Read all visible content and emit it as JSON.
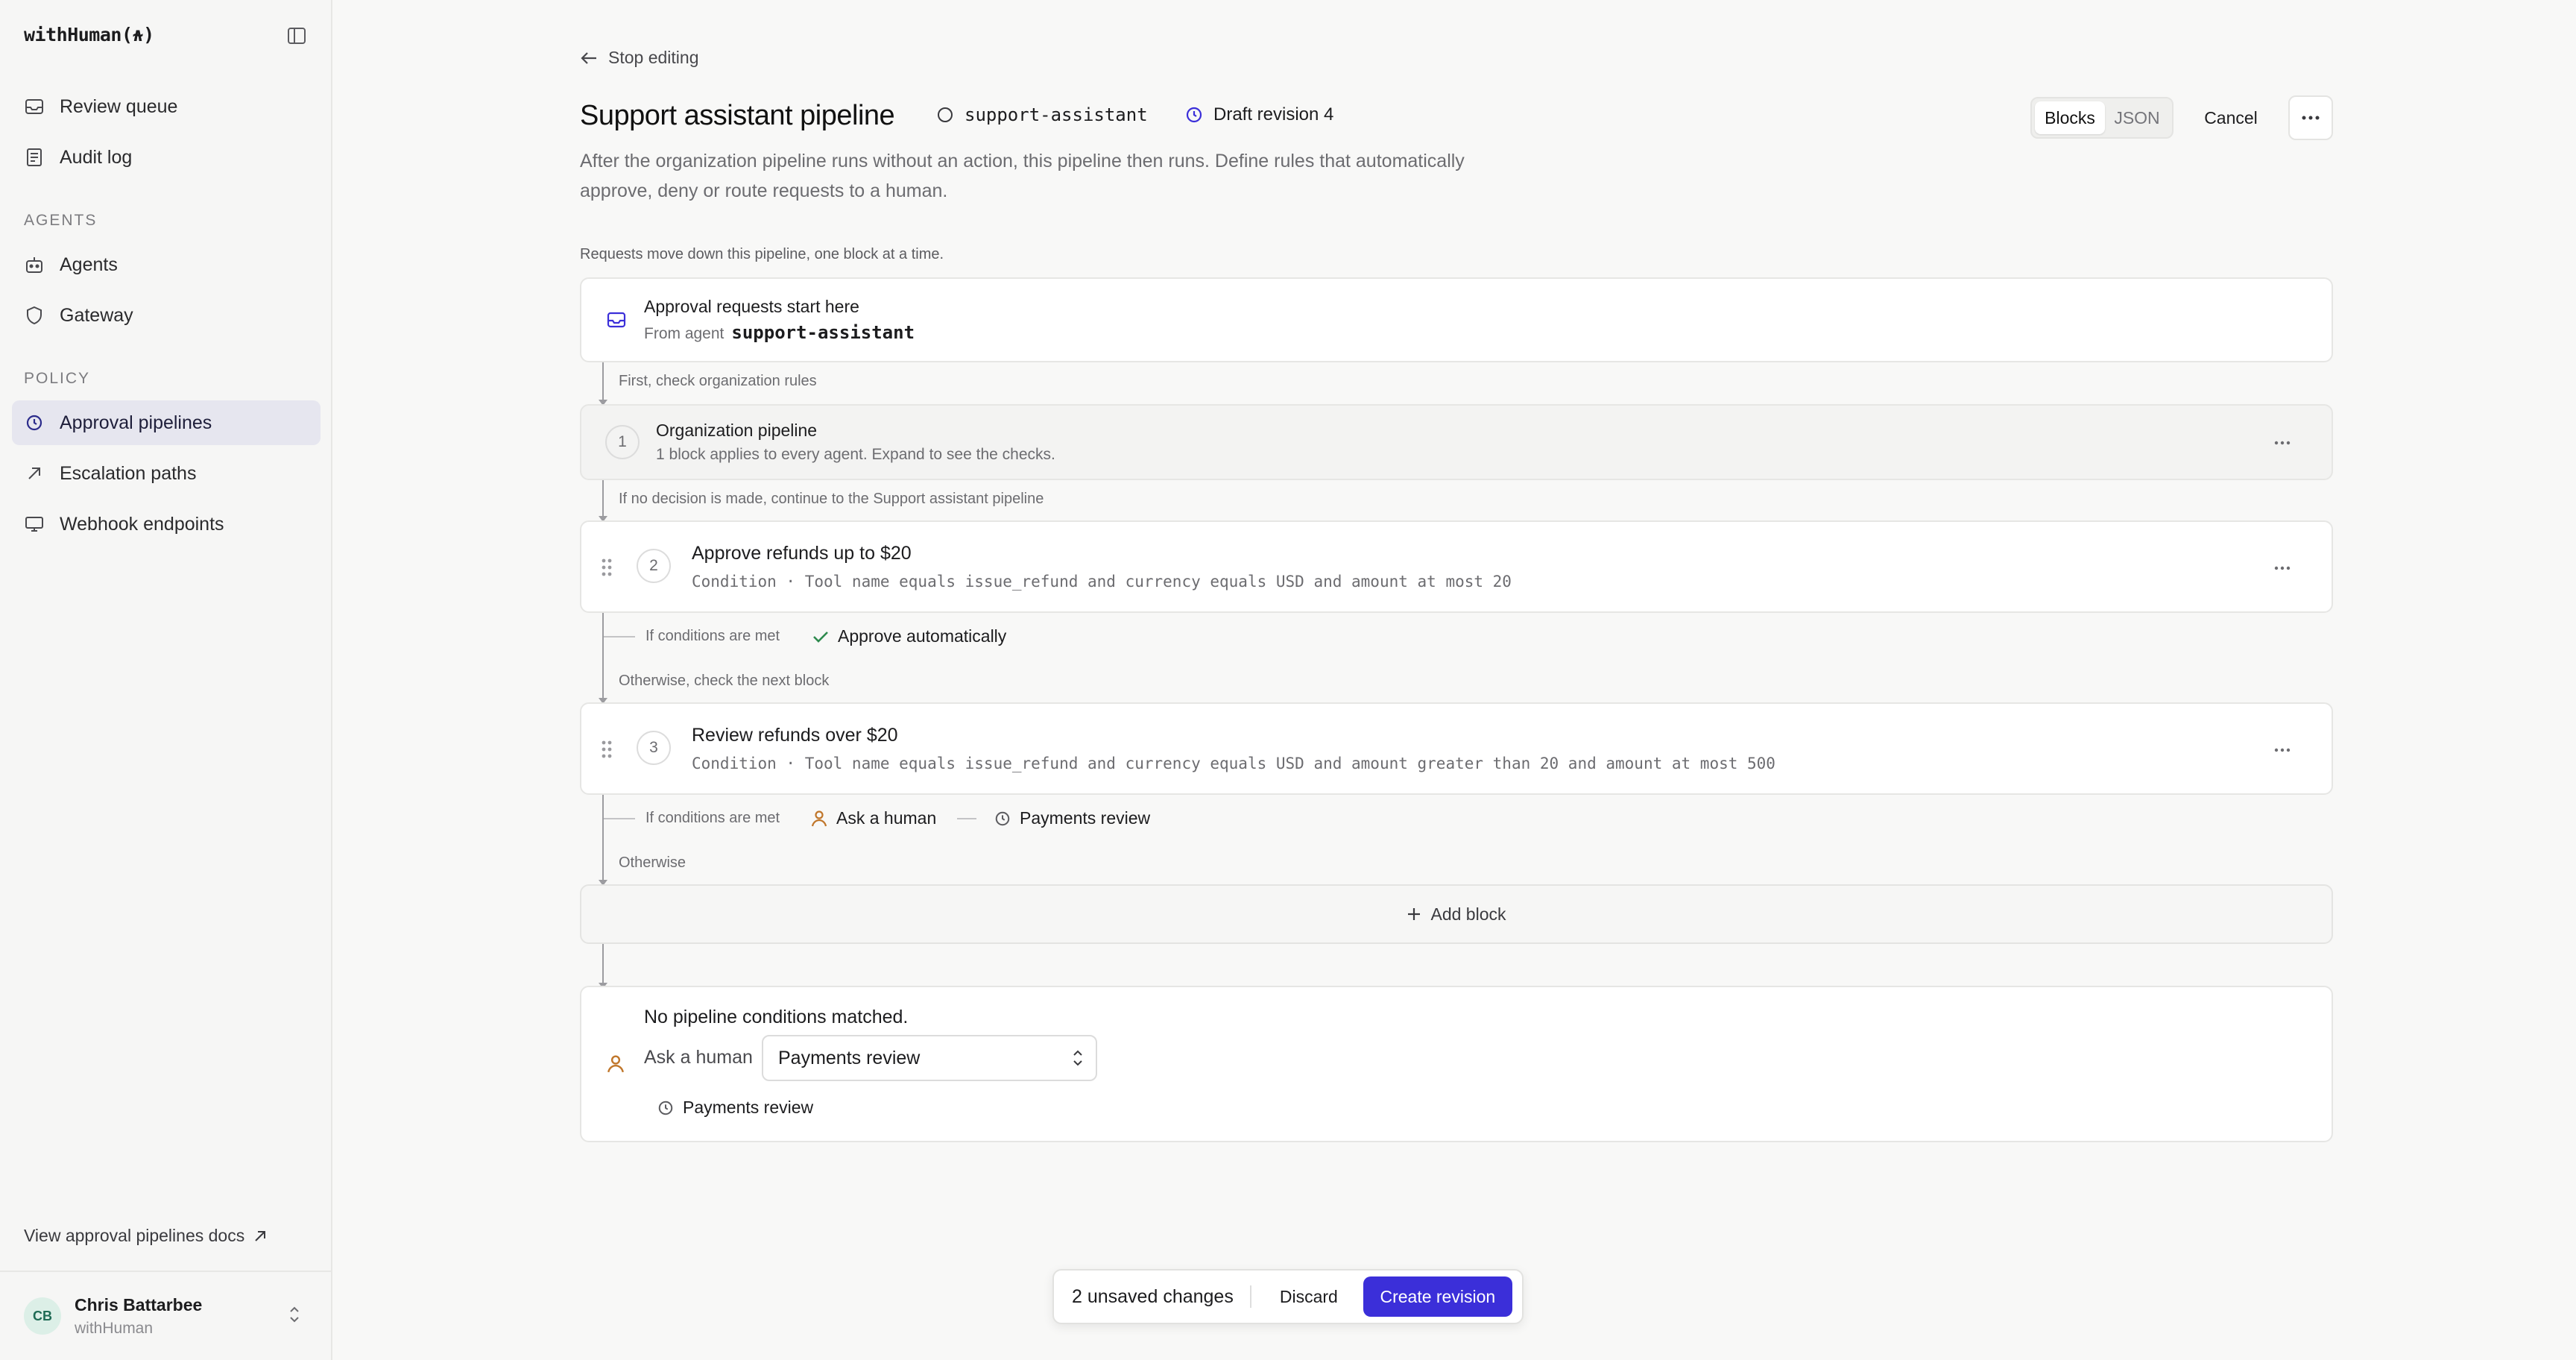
{
  "app": {
    "logo": "withHuman(⍲)"
  },
  "sidebar": {
    "items": [
      {
        "label": "Review queue",
        "icon": "inbox-icon"
      },
      {
        "label": "Audit log",
        "icon": "document-icon"
      },
      {
        "label": "Agents",
        "icon": "robot-icon"
      },
      {
        "label": "Gateway",
        "icon": "shield-icon"
      },
      {
        "label": "Approval pipelines",
        "icon": "pipeline-icon",
        "active": true
      },
      {
        "label": "Escalation paths",
        "icon": "arrow-up-right-icon"
      },
      {
        "label": "Webhook endpoints",
        "icon": "monitor-icon"
      }
    ],
    "sections": {
      "agents": "AGENTS",
      "policy": "POLICY"
    },
    "docs_link": "View approval pipelines docs",
    "user": {
      "initials": "CB",
      "name": "Chris Battarbee",
      "org": "withHuman"
    }
  },
  "header": {
    "back_label": "Stop editing",
    "title": "Support assistant pipeline",
    "agent": "support-assistant",
    "revision": "Draft revision 4",
    "view_tabs": [
      "Blocks",
      "JSON"
    ],
    "active_tab": "Blocks",
    "cancel_label": "Cancel",
    "description": "After the organization pipeline runs without an action, this pipeline then runs. Define rules that automatically approve, deny or route requests to a human."
  },
  "pipeline": {
    "hint": "Requests move down this pipeline, one block at a time.",
    "start": {
      "title": "Approval requests start here",
      "from_label": "From agent",
      "agent": "support-assistant"
    },
    "step1_label": "First, check organization rules",
    "org_block": {
      "number": "1",
      "title": "Organization pipeline",
      "subtitle": "1 block applies to every agent. Expand to see the checks."
    },
    "step2_label": "If no decision is made, continue to the Support assistant pipeline",
    "blocks": [
      {
        "number": "2",
        "title": "Approve refunds up to $20",
        "condition": "Condition · Tool name equals issue_refund and currency equals USD and amount at most 20",
        "if_label": "If conditions are met",
        "outcome": "Approve automatically",
        "next_label": "Otherwise, check the next block"
      },
      {
        "number": "3",
        "title": "Review refunds over $20",
        "condition": "Condition · Tool name equals issue_refund and currency equals USD and amount greater than 20 and amount at most 500",
        "if_label": "If conditions are met",
        "outcome": "Ask a human",
        "outcome_target": "Payments review",
        "next_label": "Otherwise"
      }
    ],
    "add_block_label": "Add block",
    "fallback": {
      "title": "No pipeline conditions matched.",
      "action_label": "Ask a human",
      "selected": "Payments review",
      "target": "Payments review"
    }
  },
  "savebar": {
    "count_label": "2 unsaved changes",
    "discard_label": "Discard",
    "create_label": "Create revision"
  },
  "colors": {
    "accent": "#3b2fd9",
    "approve": "#2e8a4e",
    "human": "#c0762a"
  }
}
